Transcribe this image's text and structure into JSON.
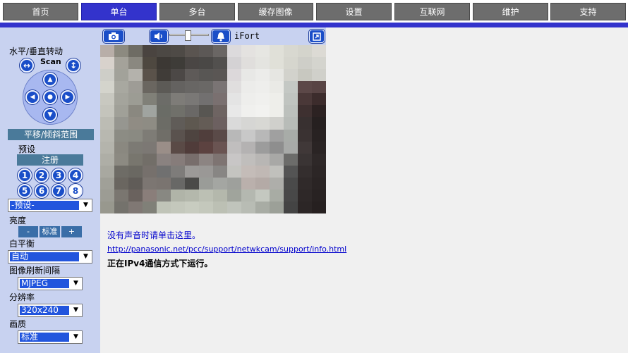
{
  "nav": {
    "tabs": [
      {
        "label": "首页",
        "active": false
      },
      {
        "label": "单台",
        "active": true
      },
      {
        "label": "多台",
        "active": false
      },
      {
        "label": "缓存图像",
        "active": false
      },
      {
        "label": "设置",
        "active": false
      },
      {
        "label": "互联网",
        "active": false
      },
      {
        "label": "维护",
        "active": false
      },
      {
        "label": "支持",
        "active": false
      }
    ]
  },
  "pan_tilt": {
    "label": "水平/垂直转动",
    "scan_label": "Scan",
    "range_label": "平移/倾斜范围"
  },
  "preset": {
    "label": "预设",
    "register_label": "注册",
    "numbers": [
      "1",
      "2",
      "3",
      "4",
      "5",
      "6",
      "7",
      "8"
    ],
    "selected": "8",
    "select_value": "-预设-"
  },
  "brightness": {
    "label": "亮度",
    "minus": "-",
    "standard": "标准",
    "plus": "+"
  },
  "white_balance": {
    "label": "白平衡",
    "value": "自动"
  },
  "refresh": {
    "label": "图像刷新间隔",
    "value": "MJPEG"
  },
  "resolution": {
    "label": "分辨率",
    "value": "320x240"
  },
  "quality": {
    "label": "画质",
    "value": "标准"
  },
  "camera": {
    "name": "iFort"
  },
  "info": {
    "no_audio": "没有声音时请单击这里。",
    "support_link": "http://panasonic.net/pcc/support/netwkcam/support/info.html",
    "status": "正在IPv4通信方式下运行。"
  },
  "icons": {
    "camera": "camera-icon",
    "speaker": "speaker-icon",
    "bell": "bell-icon",
    "fullscreen": "fullscreen-icon"
  }
}
